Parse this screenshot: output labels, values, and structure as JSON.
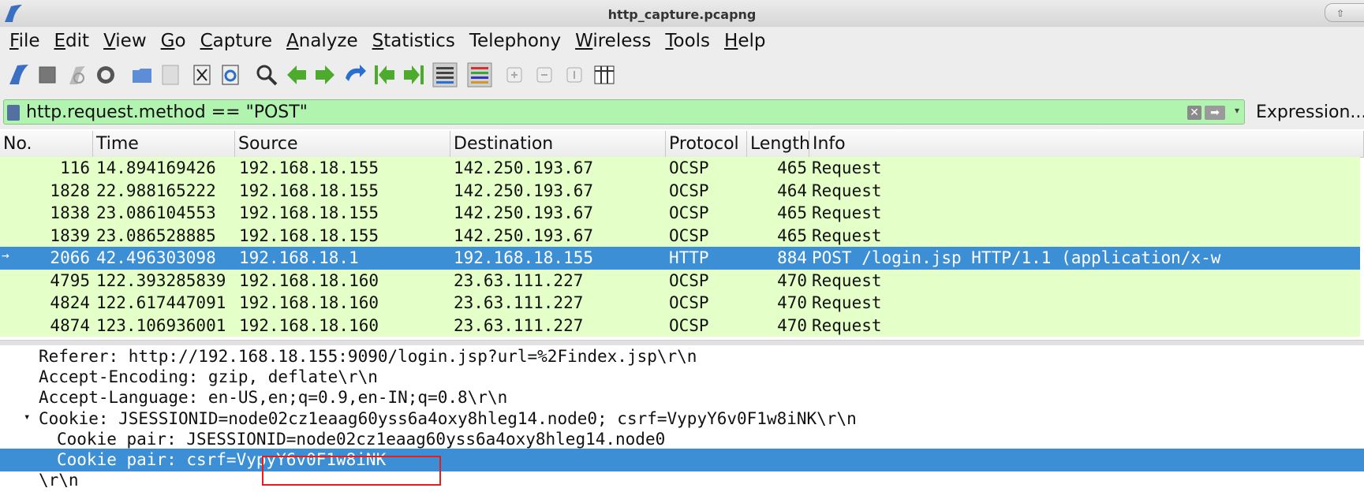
{
  "window": {
    "title": "http_capture.pcapng",
    "control_glyph": "⇧"
  },
  "menu": [
    {
      "accel": "F",
      "rest": "ile"
    },
    {
      "accel": "E",
      "rest": "dit"
    },
    {
      "accel": "V",
      "rest": "iew"
    },
    {
      "accel": "G",
      "rest": "o"
    },
    {
      "accel": "C",
      "rest": "apture"
    },
    {
      "accel": "A",
      "rest": "nalyze"
    },
    {
      "accel": "S",
      "rest": "tatistics"
    },
    {
      "accel": "",
      "rest": "Telephony"
    },
    {
      "accel": "W",
      "rest": "ireless"
    },
    {
      "accel": "T",
      "rest": "ools"
    },
    {
      "accel": "H",
      "rest": "elp"
    }
  ],
  "toolbar_icons": [
    "shark-fin-start-icon",
    "stop-capture-icon",
    "restart-capture-icon",
    "capture-options-icon",
    "open-file-icon",
    "save-file-icon",
    "close-file-icon",
    "reload-file-icon",
    "find-packet-icon",
    "go-back-icon",
    "go-forward-icon",
    "go-to-packet-icon",
    "first-packet-icon",
    "last-packet-icon",
    "autoscroll-icon",
    "colorize-icon",
    "zoom-in-icon",
    "zoom-out-icon",
    "normal-size-icon",
    "resize-columns-icon"
  ],
  "filter": {
    "value": "http.request.method == \"POST\"",
    "clear_glyph": "✕",
    "apply_glyph": "➡",
    "dropdown_glyph": "▾",
    "expression_label": "Expression..."
  },
  "columns": [
    "No.",
    "Time",
    "Source",
    "Destination",
    "Protocol",
    "Length",
    "Info"
  ],
  "packets": [
    {
      "no": "116",
      "time": "14.894169426",
      "src": "192.168.18.155",
      "dst": "142.250.193.67",
      "proto": "OCSP",
      "len": "465",
      "info": "Request",
      "selected": false
    },
    {
      "no": "1828",
      "time": "22.988165222",
      "src": "192.168.18.155",
      "dst": "142.250.193.67",
      "proto": "OCSP",
      "len": "464",
      "info": "Request",
      "selected": false
    },
    {
      "no": "1838",
      "time": "23.086104553",
      "src": "192.168.18.155",
      "dst": "142.250.193.67",
      "proto": "OCSP",
      "len": "465",
      "info": "Request",
      "selected": false
    },
    {
      "no": "1839",
      "time": "23.086528885",
      "src": "192.168.18.155",
      "dst": "142.250.193.67",
      "proto": "OCSP",
      "len": "465",
      "info": "Request",
      "selected": false
    },
    {
      "no": "2066",
      "time": "42.496303098",
      "src": "192.168.18.1",
      "dst": "192.168.18.155",
      "proto": "HTTP",
      "len": "884",
      "info": "POST /login.jsp HTTP/1.1  (application/x-w",
      "selected": true
    },
    {
      "no": "4795",
      "time": "122.393285839",
      "src": "192.168.18.160",
      "dst": "23.63.111.227",
      "proto": "OCSP",
      "len": "470",
      "info": "Request",
      "selected": false
    },
    {
      "no": "4824",
      "time": "122.617447091",
      "src": "192.168.18.160",
      "dst": "23.63.111.227",
      "proto": "OCSP",
      "len": "470",
      "info": "Request",
      "selected": false
    },
    {
      "no": "4874",
      "time": "123.106936001",
      "src": "192.168.18.160",
      "dst": "23.63.111.227",
      "proto": "OCSP",
      "len": "470",
      "info": "Request",
      "selected": false
    }
  ],
  "details": [
    {
      "text": "Referer: http://192.168.18.155:9090/login.jsp?url=%2Findex.jsp\\r\\n",
      "indent": 1,
      "expander": "",
      "selected": false
    },
    {
      "text": "Accept-Encoding: gzip, deflate\\r\\n",
      "indent": 1,
      "expander": "",
      "selected": false
    },
    {
      "text": "Accept-Language: en-US,en;q=0.9,en-IN;q=0.8\\r\\n",
      "indent": 1,
      "expander": "",
      "selected": false
    },
    {
      "text": "Cookie: JSESSIONID=node02cz1eaag60yss6a4oxy8hleg14.node0; csrf=VypyY6v0F1w8iNK\\r\\n",
      "indent": 1,
      "expander": "▾",
      "selected": false
    },
    {
      "text": "Cookie pair: JSESSIONID=node02cz1eaag60yss6a4oxy8hleg14.node0",
      "indent": 2,
      "expander": "",
      "selected": false
    },
    {
      "text": "Cookie pair: csrf=VypyY6v0F1w8iNK",
      "indent": 2,
      "expander": "",
      "selected": true
    },
    {
      "text": "\\r\\n",
      "indent": 1,
      "expander": "",
      "selected": false
    }
  ],
  "colors": {
    "row_bg": "#e4ffc7",
    "selected_bg": "#3c8fd4",
    "filter_bg": "#b0f4b0",
    "highlight_border": "#e02020"
  }
}
